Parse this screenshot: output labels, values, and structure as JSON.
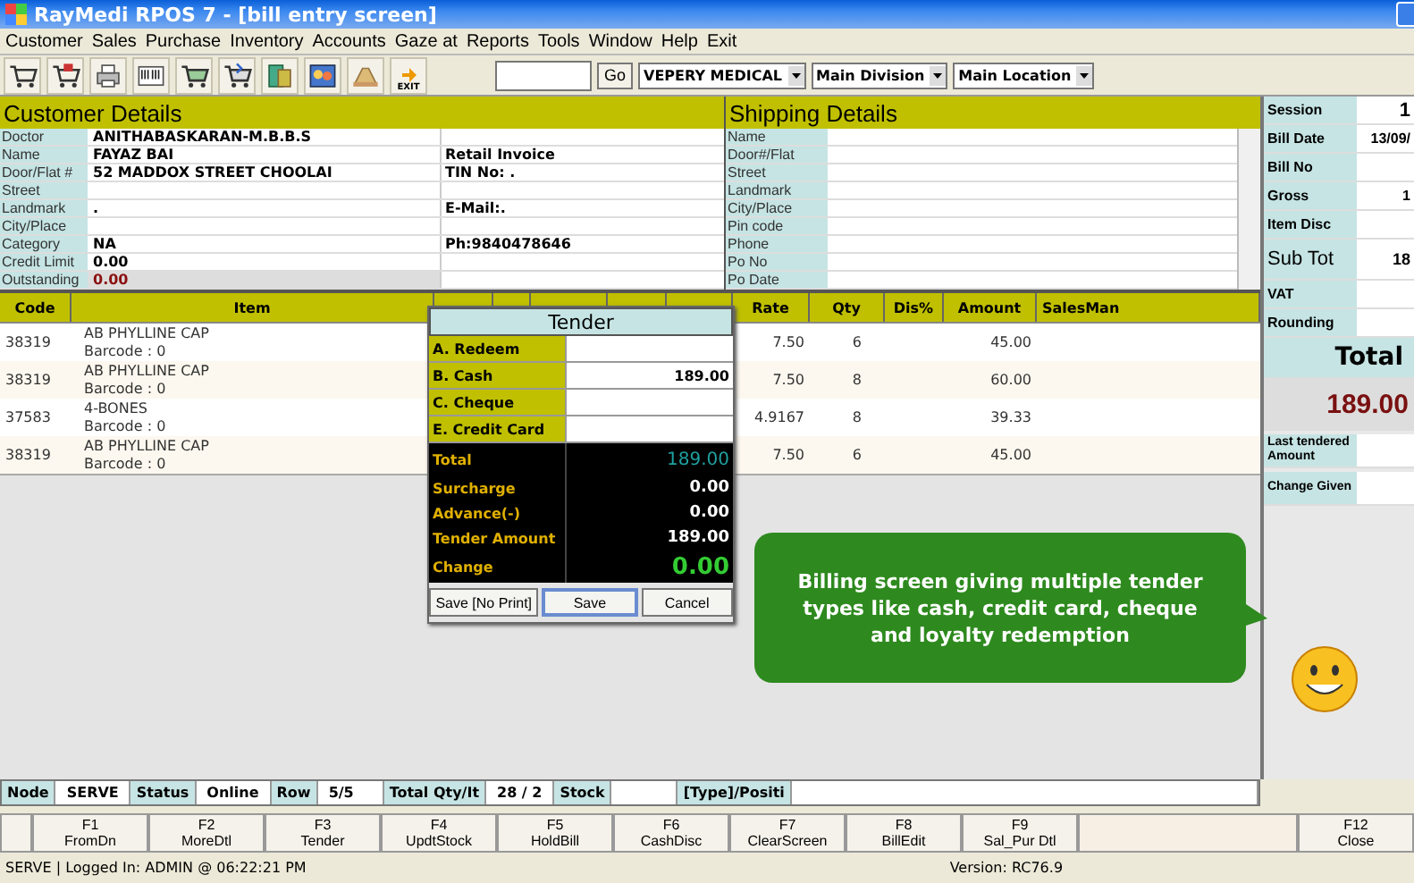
{
  "window": {
    "title": "RayMedi RPOS 7 - [bill entry screen]"
  },
  "menu": [
    "Customer",
    "Sales",
    "Purchase",
    "Inventory",
    "Accounts",
    "Gaze at",
    "Reports",
    "Tools",
    "Window",
    "Help",
    "Exit"
  ],
  "toolbar": {
    "exit_label": "EXIT",
    "go": "Go",
    "selects": [
      "VEPERY MEDICAL",
      "Main Division",
      "Main Location"
    ]
  },
  "customer": {
    "title": "Customer Details",
    "rows": [
      {
        "label": "Doctor",
        "value": "ANITHABASKARAN-M.B.B.S",
        "highlight": false
      },
      {
        "label": "Name",
        "value": "FAYAZ BAI",
        "extra": "Retail Invoice",
        "highlight": false
      },
      {
        "label": "Door/Flat #",
        "value": "52 MADDOX STREET CHOOLAI",
        "extra": "TIN No: .",
        "highlight": false
      },
      {
        "label": "Street",
        "highlight": false
      },
      {
        "label": "Landmark",
        "value": ".",
        "extra": "E-Mail:.",
        "highlight": false
      },
      {
        "label": "City/Place",
        "highlight": false
      },
      {
        "label": "Category",
        "value": "NA",
        "extra": "Ph:9840478646",
        "highlight": false
      },
      {
        "label": "Credit Limit",
        "value": "0.00",
        "highlight": false
      },
      {
        "label": "Outstanding",
        "value": "0.00",
        "highlight": true
      }
    ]
  },
  "shipping": {
    "title": "Shipping Details",
    "labels": [
      "Name",
      "Door#/Flat",
      "Street",
      "Landmark",
      "City/Place",
      "Pin code",
      "Phone",
      "Po No",
      "Po Date"
    ]
  },
  "summary": [
    {
      "label": "Session",
      "value": "1",
      "kind": "big"
    },
    {
      "label": "Bill Date",
      "value": "13/09/",
      "kind": "normal"
    },
    {
      "label": "Bill No",
      "kind": "normal"
    },
    {
      "label": "Gross",
      "value": "1",
      "kind": "normal"
    },
    {
      "label": "Item Disc",
      "kind": "normal"
    },
    {
      "label": "Sub Tot",
      "value": "18",
      "kind": "large"
    },
    {
      "label": "VAT",
      "kind": "normal"
    },
    {
      "label": "Rounding",
      "kind": "normal"
    }
  ],
  "total": {
    "label": "Total",
    "value": "189.00"
  },
  "after": [
    {
      "label": "Last tendered Amount"
    },
    {
      "label": "Change Given"
    }
  ],
  "table": {
    "columns": [
      "Code",
      "Item",
      "",
      "",
      "",
      "",
      "",
      "Rate",
      "Qty",
      "Dis%",
      "Amount",
      "SalesMan"
    ],
    "rows": [
      {
        "code": "38319",
        "item": "AB PHYLLINE CAP",
        "barcode": "Barcode : 0",
        "rate": "7.50",
        "qty": "6",
        "amount": "45.00"
      },
      {
        "code": "38319",
        "item": "AB PHYLLINE CAP",
        "barcode": "Barcode : 0",
        "rate": "7.50",
        "qty": "8",
        "amount": "60.00"
      },
      {
        "code": "37583",
        "item": "4-BONES",
        "barcode": "Barcode : 0",
        "rate": "4.9167",
        "qty": "8",
        "amount": "39.33"
      },
      {
        "code": "38319",
        "item": "AB PHYLLINE CAP",
        "barcode": "Barcode : 0",
        "rate": "7.50",
        "qty": "6",
        "amount": "45.00"
      }
    ]
  },
  "tender": {
    "title": "Tender",
    "methods": [
      {
        "label": "A. Redeem"
      },
      {
        "label": "B. Cash",
        "value": "189.00"
      },
      {
        "label": "C. Cheque"
      },
      {
        "label": "E. Credit Card"
      }
    ],
    "totals": [
      {
        "label": "Total",
        "value": "189.00",
        "kind": "total"
      },
      {
        "label": "Surcharge",
        "value": "0.00",
        "kind": "normal"
      },
      {
        "label": "Advance(-)",
        "value": "0.00",
        "kind": "normal"
      },
      {
        "label": "Tender Amount",
        "value": "189.00",
        "kind": "normal"
      },
      {
        "label": "Change",
        "value": "0.00",
        "kind": "change"
      }
    ],
    "buttons": [
      {
        "label": "Save [No Print]",
        "selected": false
      },
      {
        "label": "Save",
        "selected": true
      },
      {
        "label": "Cancel",
        "selected": false
      }
    ]
  },
  "callout": "Billing screen giving multiple tender types like cash, credit card, cheque and loyalty redemption",
  "status_row": [
    {
      "label": "Node",
      "value": "SERVE"
    },
    {
      "label": "Status",
      "value": "Online"
    },
    {
      "label": "Row",
      "value": "5/5"
    },
    {
      "label": "Total Qty/It",
      "value": "28 / 2"
    },
    {
      "label": "Stock"
    },
    {
      "label": "[Type]/Positi"
    }
  ],
  "fkeys": [
    {
      "key": "F1",
      "label": "FromDn"
    },
    {
      "key": "F2",
      "label": "MoreDtl"
    },
    {
      "key": "F3",
      "label": "Tender"
    },
    {
      "key": "F4",
      "label": "UpdtStock"
    },
    {
      "key": "F5",
      "label": "HoldBill"
    },
    {
      "key": "F6",
      "label": "CashDisc"
    },
    {
      "key": "F7",
      "label": "ClearScreen"
    },
    {
      "key": "F8",
      "label": "BillEdit"
    },
    {
      "key": "F9",
      "label": "Sal_Pur Dtl"
    },
    {
      "key": "F12",
      "label": "Close"
    }
  ],
  "status_bar": {
    "left": "SERVE |  Logged In: ADMIN  @ 06:22:21 PM",
    "version": "Version: RC76.9"
  }
}
